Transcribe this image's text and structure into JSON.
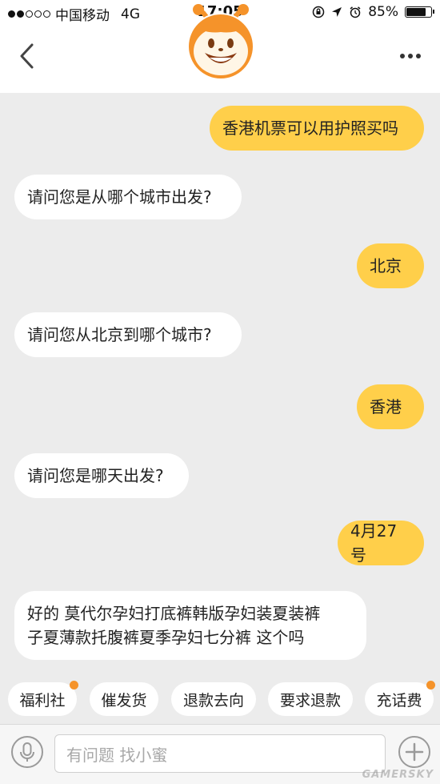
{
  "status_bar": {
    "carrier": "中国移动",
    "network": "4G",
    "time": "17:05",
    "battery": "85%",
    "battery_level": 0.85
  },
  "header": {
    "back_icon": "chevron-left-icon",
    "more_icon": "more-dots-icon",
    "avatar_icon": "smiley-bee-mascot-icon"
  },
  "messages": [
    {
      "from": "me",
      "text": "香港机票可以用护照买吗"
    },
    {
      "from": "them",
      "text": "请问您是从哪个城市出发?"
    },
    {
      "from": "me",
      "text": "北京"
    },
    {
      "from": "them",
      "text": "请问您从北京到哪个城市?"
    },
    {
      "from": "me",
      "text": "香港"
    },
    {
      "from": "them",
      "text": "请问您是哪天出发?"
    },
    {
      "from": "me",
      "text": "4月27号"
    },
    {
      "from": "them",
      "text_line1": "好的 莫代尔孕妇打底裤韩版孕妇装夏装裤",
      "text_line2": "子夏薄款托腹裤夏季孕妇七分裤 这个吗"
    }
  ],
  "quick_replies": [
    "福利社",
    "催发货",
    "退款去向",
    "要求退款",
    "充话费"
  ],
  "input": {
    "placeholder": "有问题 找小蜜",
    "mic_icon": "microphone-icon",
    "plus_icon": "plus-icon"
  },
  "watermark": "GAMERSKY",
  "colors": {
    "accent": "#ffcf4a",
    "mascot_orange": "#f5932a",
    "background": "#ececec"
  }
}
